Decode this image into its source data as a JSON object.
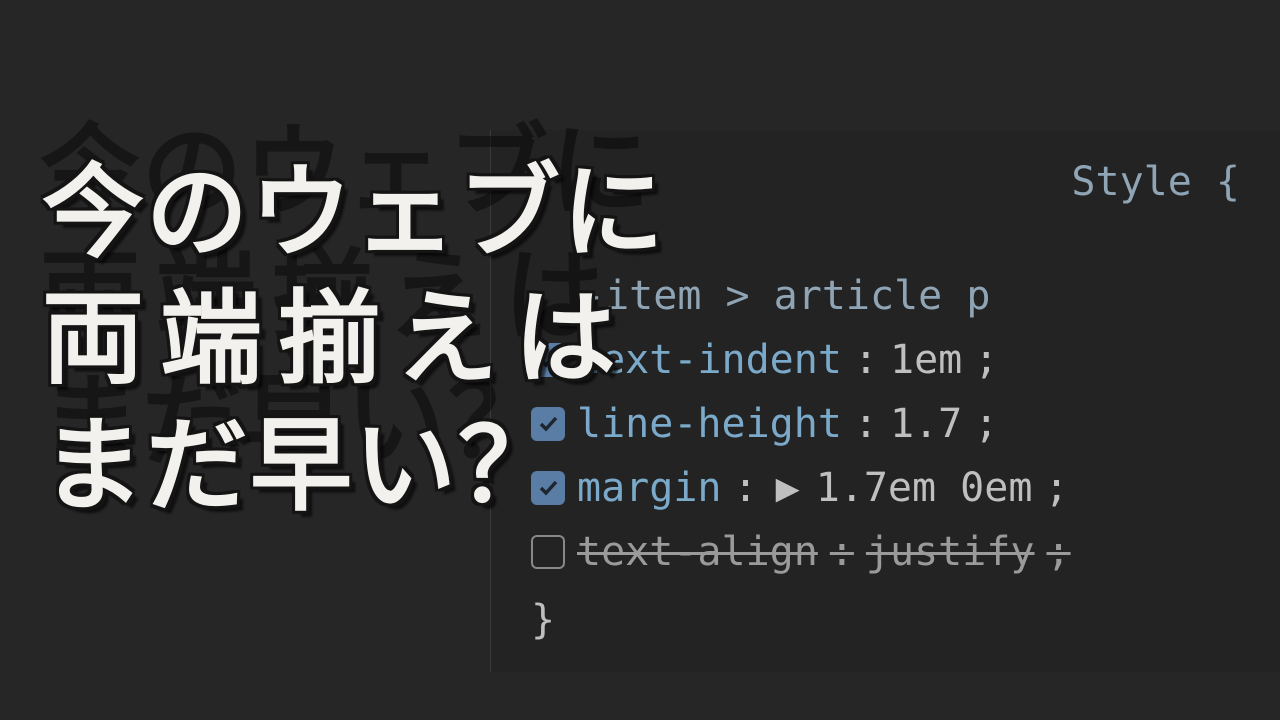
{
  "title": {
    "line1": "今のウェブに",
    "line2": "両端揃えは",
    "line3": "まだ早い？"
  },
  "css_panel": {
    "style_label": "Style {",
    "selector": "-item > article p",
    "rules": [
      {
        "enabled": true,
        "property": "text-indent",
        "value": "1em",
        "expandable": false
      },
      {
        "enabled": true,
        "property": "line-height",
        "value": "1.7",
        "expandable": false
      },
      {
        "enabled": true,
        "property": "margin",
        "value": "1.7em 0em",
        "expandable": true
      },
      {
        "enabled": false,
        "property": "text-align",
        "value": "justify",
        "expandable": false
      }
    ],
    "close_brace": "}"
  }
}
